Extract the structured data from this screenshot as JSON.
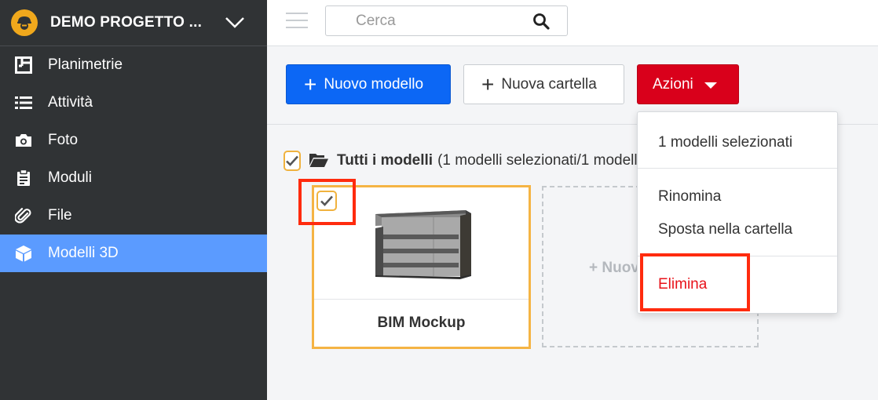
{
  "project": {
    "name": "DEMO PROGETTO ..."
  },
  "sidebar": {
    "items": [
      {
        "label": "Planimetrie",
        "icon": "floor-plan-icon"
      },
      {
        "label": "Attività",
        "icon": "list-icon"
      },
      {
        "label": "Foto",
        "icon": "camera-icon"
      },
      {
        "label": "Moduli",
        "icon": "clipboard-icon"
      },
      {
        "label": "File",
        "icon": "paperclip-icon"
      },
      {
        "label": "Modelli 3D",
        "icon": "cube-icon",
        "active": true
      }
    ]
  },
  "search": {
    "placeholder": "Cerca",
    "value": ""
  },
  "toolbar": {
    "new_model": "Nuovo modello",
    "new_folder": "Nuova cartella",
    "actions": "Azioni"
  },
  "folder": {
    "name": "Tutti i modelli",
    "info": "(1 modelli selezionati/1 modelli)"
  },
  "models": [
    {
      "title": "BIM Mockup",
      "checked": true
    }
  ],
  "new_card": {
    "label": "+ Nuovo modello"
  },
  "actions_menu": {
    "header": "1 modelli selezionati",
    "rename": "Rinomina",
    "move": "Sposta nella cartella",
    "delete": "Elimina"
  },
  "colors": {
    "sidebar_bg": "#303335",
    "active_item": "#5b9bff",
    "primary": "#0c67f5",
    "danger": "#d9001b",
    "highlight": "#ff2b0e",
    "checkbox_border": "#f0b23e"
  }
}
